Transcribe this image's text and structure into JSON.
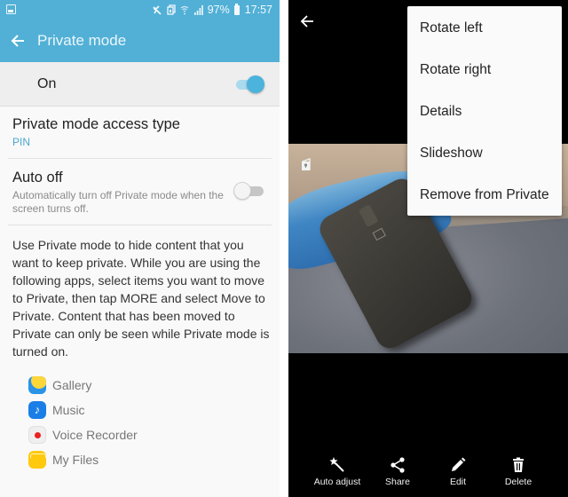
{
  "left_screen": {
    "status_bar": {
      "notification_icon": "image-icon",
      "icons": [
        "mute-vibrate-icon",
        "nfc-icon",
        "wifi-icon",
        "signal-icon"
      ],
      "battery_percent": "97%",
      "time": "17:57"
    },
    "app_bar": {
      "title": "Private mode",
      "back_icon": "back-arrow-icon"
    },
    "master_switch": {
      "label": "On",
      "checked": true
    },
    "settings": [
      {
        "title": "Private mode access type",
        "value": "PIN"
      },
      {
        "title": "Auto off",
        "summary": "Automatically turn off Private mode when the screen turns off.",
        "checked": false
      }
    ],
    "description": "Use Private mode to hide content that you want to keep private. While you are using the following apps, select items you want to move to Private, then tap MORE and select Move to Private. Content that has been moved to Private can only be seen while Private mode is turned on.",
    "apps": [
      {
        "label": "Gallery",
        "icon": "gallery-icon"
      },
      {
        "label": "Music",
        "icon": "music-icon",
        "glyph": "♪"
      },
      {
        "label": "Voice Recorder",
        "icon": "voice-recorder-icon"
      },
      {
        "label": "My Files",
        "icon": "my-files-icon"
      }
    ]
  },
  "right_screen": {
    "back_icon": "back-arrow-icon",
    "private_badge": "private-lock-icon",
    "menu": {
      "items": [
        "Rotate left",
        "Rotate right",
        "Details",
        "Slideshow",
        "Remove from Private"
      ]
    },
    "toolbar": [
      {
        "label": "Auto adjust",
        "icon": "magic-wand-icon"
      },
      {
        "label": "Share",
        "icon": "share-icon"
      },
      {
        "label": "Edit",
        "icon": "pencil-icon"
      },
      {
        "label": "Delete",
        "icon": "trash-icon"
      }
    ]
  },
  "colors": {
    "app_bar": "#52b0d6",
    "accent": "#4aa7cf",
    "switch_on": "#4bb3dc"
  }
}
